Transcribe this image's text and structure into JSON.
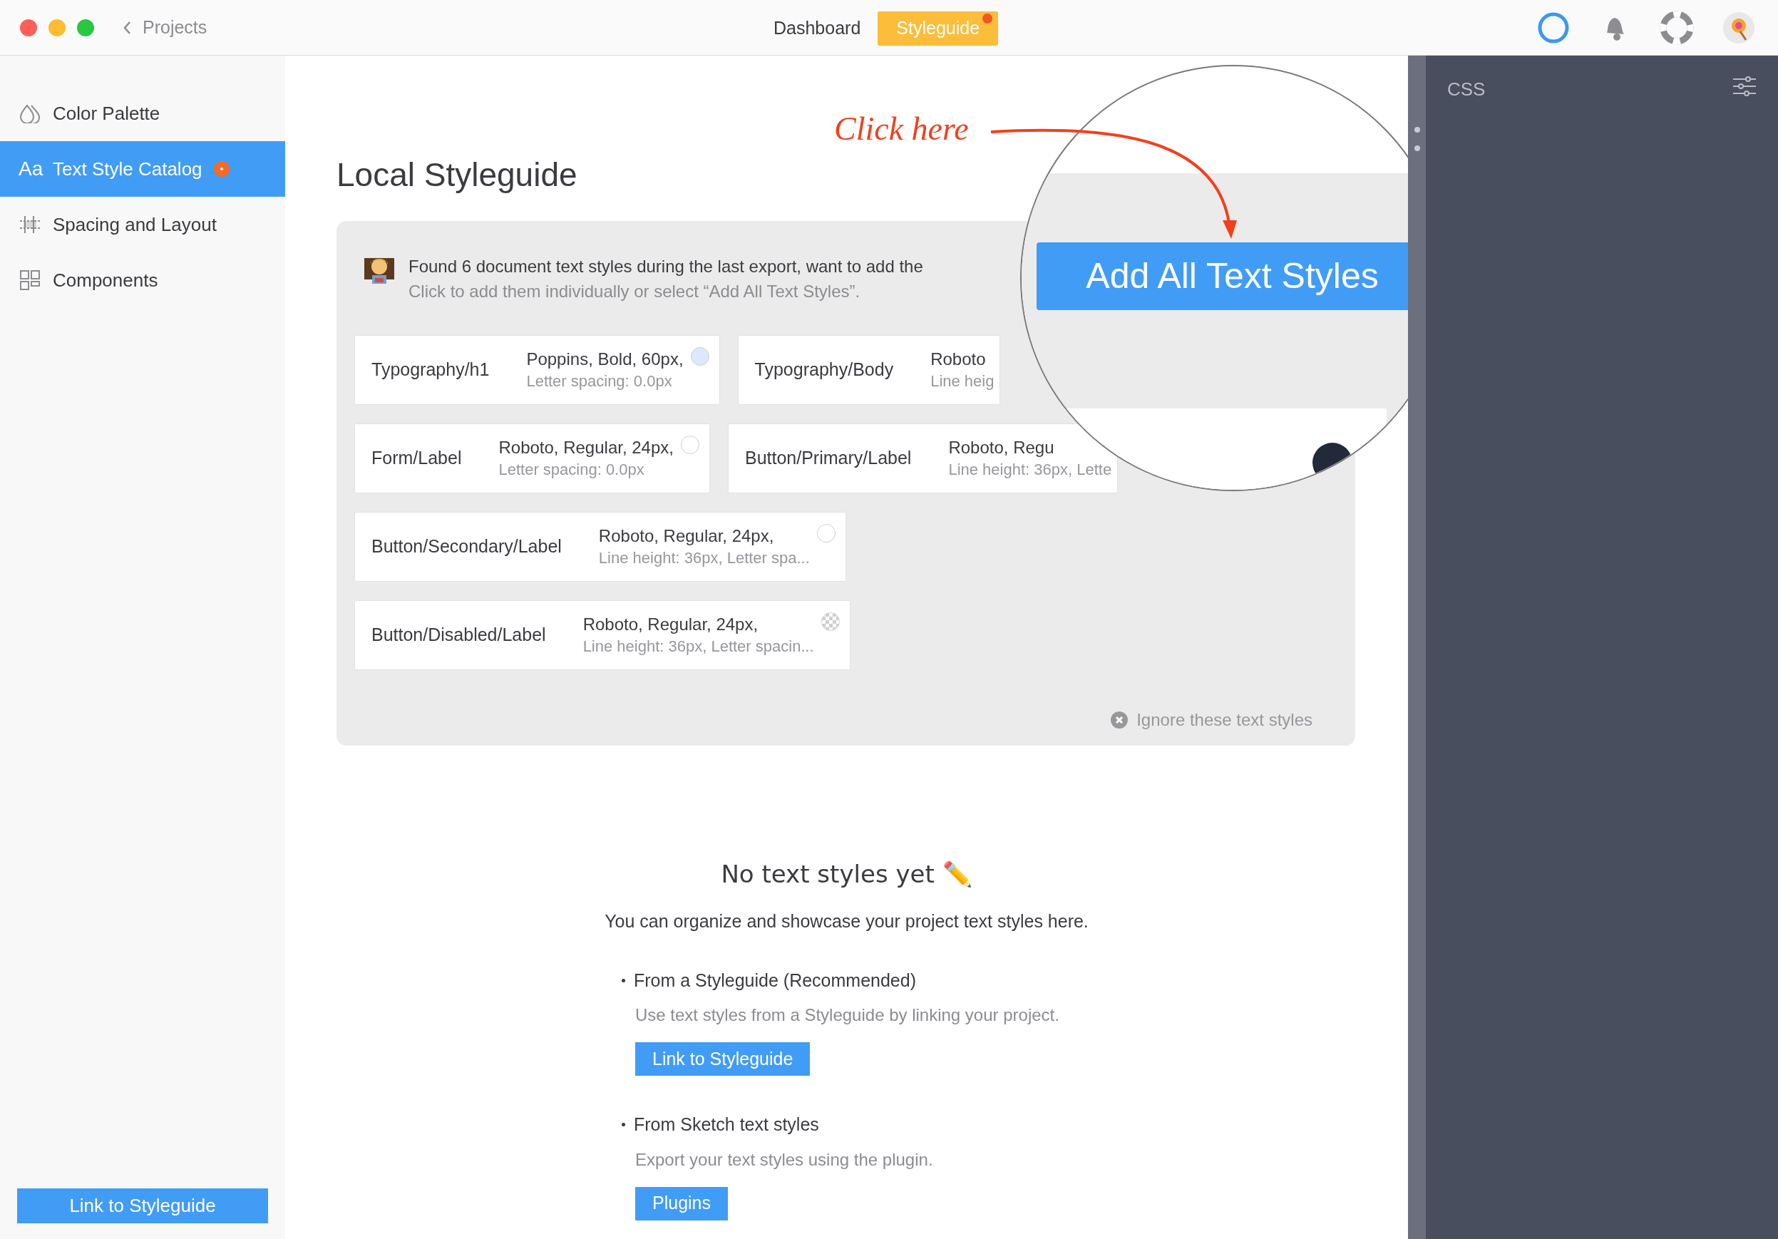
{
  "topbar": {
    "back": "Projects",
    "tabs": [
      {
        "label": "Dashboard",
        "selected": false,
        "notification": false
      },
      {
        "label": "Styleguide",
        "selected": true,
        "notification": true
      }
    ]
  },
  "sidebar": {
    "items": [
      {
        "label": "Color Palette",
        "selected": false,
        "badge": false
      },
      {
        "label": "Text Style Catalog",
        "glyph": "Aa",
        "selected": true,
        "badge": true
      },
      {
        "label": "Spacing and Layout",
        "selected": false,
        "badge": false
      },
      {
        "label": "Components",
        "selected": false,
        "badge": false
      }
    ],
    "button": "Link to Styleguide"
  },
  "main": {
    "title": "Local Styleguide",
    "notice": {
      "title": "Found 6 document text styles during the last export, want to add the",
      "subtitle": "Click to add them individually or select “Add All Text Styles”."
    },
    "styles": [
      {
        "name": "Typography/h1",
        "line_1": "Poppins, Bold, 60px,",
        "line_2": "Letter spacing: 0.0px",
        "color": "#dce8fb",
        "transparent": false
      },
      {
        "name": "Typography/Body",
        "line_1": "Roboto",
        "line_2": "Line heig"
      },
      {
        "name": "Form/Label",
        "line_1": "Roboto, Regular, 24px,",
        "line_2": "Letter spacing: 0.0px",
        "color": "#ffffff",
        "transparent": false
      },
      {
        "name": "Button/Primary/Label",
        "line_1": "Roboto, Regu",
        "line_2": "Line height: 36px, Lette"
      },
      {
        "name": "Button/Secondary/Label",
        "line_1": "Roboto, Regular, 24px,",
        "line_2": "Line height: 36px, Letter spa...",
        "color": "#ffffff",
        "transparent": false
      },
      {
        "name": "Button/Disabled/Label",
        "line_1": "Roboto, Regular, 24px,",
        "line_2": "Line height: 36px, Letter spacin...",
        "color": "#ffffff",
        "transparent": true
      }
    ],
    "ignore": "Ignore these text styles",
    "empty": {
      "title": "No text styles yet ✏️",
      "text": "You can organize and showcase your project text styles here.",
      "options": [
        {
          "title": "From a Styleguide (Recommended)",
          "text": "Use text styles from a Styleguide by linking your project.",
          "button": "Link to Styleguide"
        },
        {
          "title": "From Sketch text styles",
          "text": "Export your text styles using the plugin.",
          "button": "Plugins"
        }
      ]
    },
    "callout": {
      "label": "Click here",
      "button": "Add All Text Styles"
    }
  },
  "panel": {
    "title": "CSS"
  }
}
